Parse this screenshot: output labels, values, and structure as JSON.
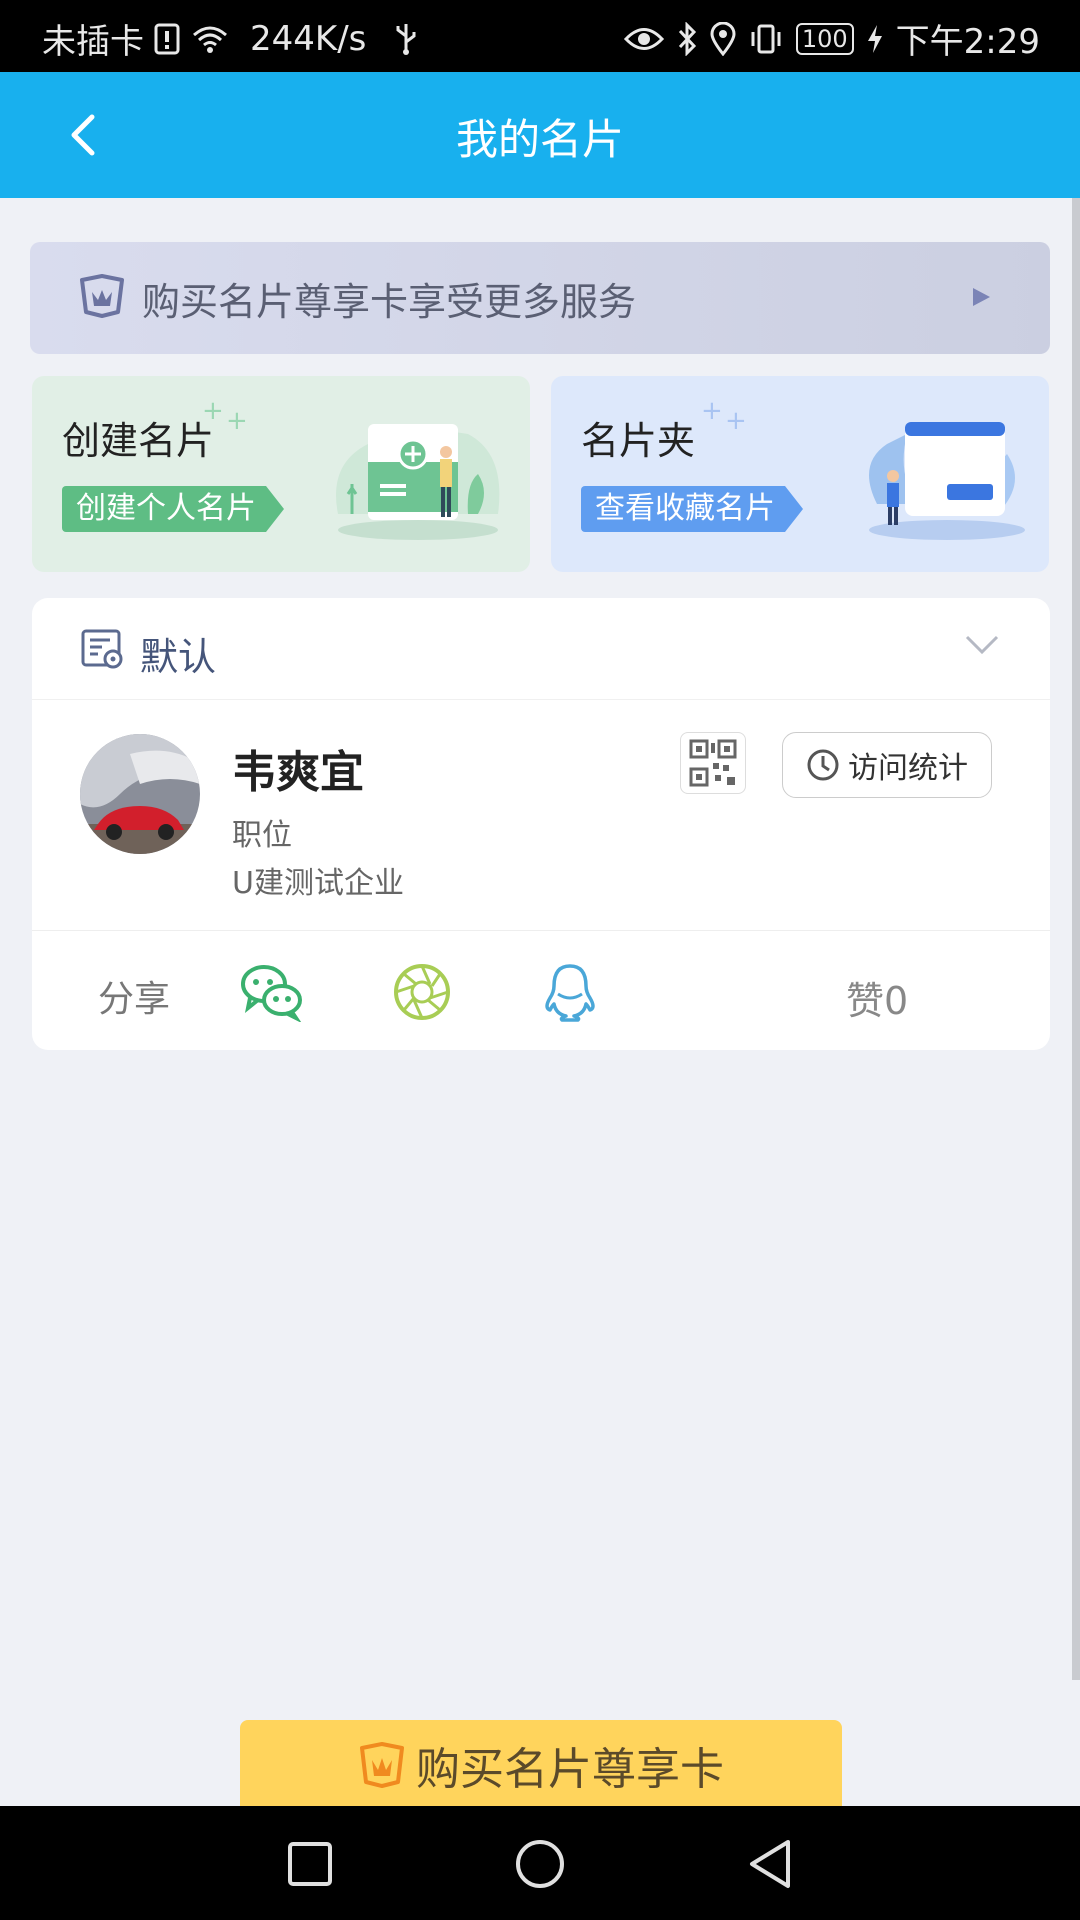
{
  "status_bar": {
    "carrier": "未插卡",
    "speed": "244K/s",
    "battery": "100",
    "time": "下午2:29"
  },
  "header": {
    "title": "我的名片"
  },
  "banner": {
    "text": "购买名片尊享卡享受更多服务"
  },
  "tiles": [
    {
      "title": "创建名片",
      "tag": "创建个人名片"
    },
    {
      "title": "名片夹",
      "tag": "查看收藏名片"
    }
  ],
  "card": {
    "group_label": "默认",
    "name": "韦爽宜",
    "position": "职位",
    "company": "U建测试企业",
    "visit_label": "访问统计",
    "share_label": "分享",
    "likes": "赞0"
  },
  "buy_button": {
    "label": "购买名片尊享卡"
  },
  "colors": {
    "header_bg": "#18b0ee",
    "page_bg": "#eff1f6",
    "buy_button_bg": "#ffd45c",
    "create_tag": "#5ebd84",
    "folder_tag": "#5f9df0"
  },
  "icons": [
    "back-arrow-icon",
    "crown-icon",
    "play-arrow-icon",
    "card-icon",
    "chevron-down-icon",
    "qr-code-icon",
    "clock-icon",
    "wechat-icon",
    "moments-icon",
    "qq-icon"
  ]
}
